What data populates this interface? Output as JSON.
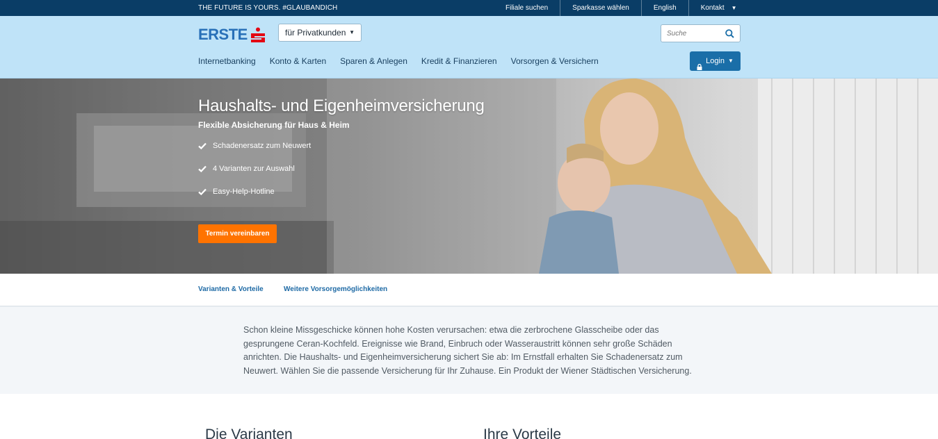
{
  "topbar": {
    "tagline": "THE FUTURE IS YOURS. #GLAUBANDICH",
    "links": [
      "Filiale suchen",
      "Sparkasse wählen",
      "English",
      "Kontakt"
    ]
  },
  "header": {
    "logo_text": "ERSTE",
    "segment_label": "für  Privatkunden",
    "search_placeholder": "Suche",
    "nav": [
      "Internetbanking",
      "Konto & Karten",
      "Sparen & Anlegen",
      "Kredit & Finanzieren",
      "Vorsorgen & Versichern"
    ],
    "login_label": "Login"
  },
  "hero": {
    "title": "Haushalts- und Eigenheimversicherung",
    "subtitle": "Flexible Absicherung für Haus & Heim",
    "benefits": [
      "Schadenersatz zum Neuwert",
      "4 Varianten zur Auswahl",
      "Easy-Help-Hotline"
    ],
    "cta_label": "Termin vereinbaren"
  },
  "anchors": [
    "Varianten & Vorteile",
    "Weitere Vorsorgemöglichkeiten"
  ],
  "intro": {
    "text": "Schon kleine Missgeschicke können hohe Kosten verursachen: etwa die zerbrochene Glasscheibe oder das gesprungene Ceran-Kochfeld. Ereignisse wie Brand, Einbruch oder Wasseraustritt können sehr große Schäden anrichten. Die Haushalts- und Eigenheimversicherung sichert Sie ab: Im Ernstfall erhalten Sie Schadenersatz zum Neuwert. Wählen Sie die passende Versicherung für Ihr Zuhause. Ein Produkt der Wiener Städtischen Versicherung."
  },
  "sections": {
    "left_heading": "Die Varianten",
    "right_heading": "Ihre Vorteile"
  },
  "colors": {
    "topbar": "#0a3d66",
    "header": "#bfe3f8",
    "brand_blue": "#2870b8",
    "brand_red": "#e30613",
    "login": "#1a6ea8",
    "cta": "#ff7300",
    "link": "#1e6aa5"
  }
}
